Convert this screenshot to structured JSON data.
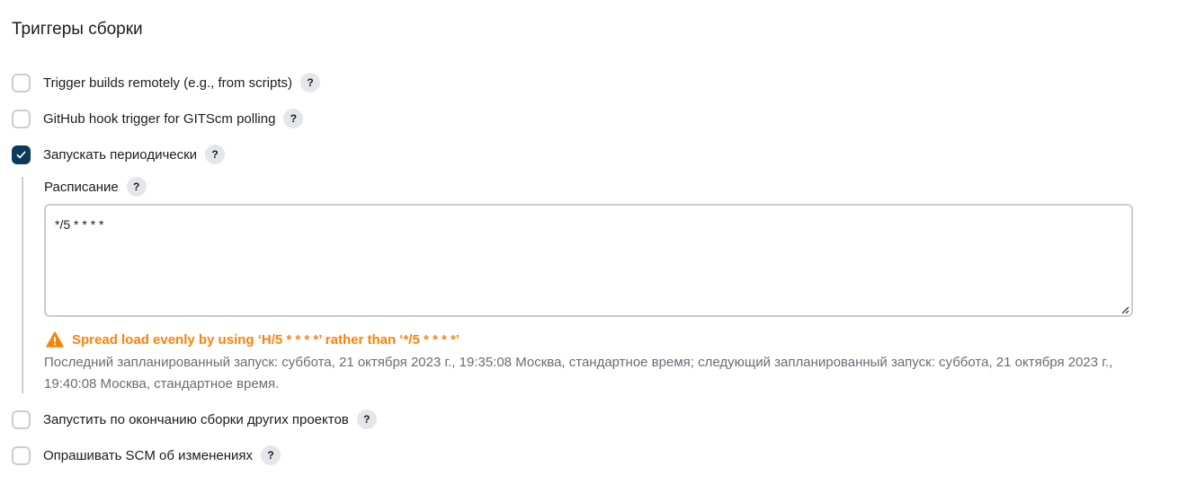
{
  "section": {
    "title": "Триггеры сборки"
  },
  "triggers": [
    {
      "label": "Trigger builds remotely (e.g., from scripts)",
      "checked": false,
      "help": "?"
    },
    {
      "label": "GitHub hook trigger for GITScm polling",
      "checked": false,
      "help": "?"
    },
    {
      "label": "Запускать периодически",
      "checked": true,
      "help": "?"
    },
    {
      "label": "Запустить по окончанию сборки других проектов",
      "checked": false,
      "help": "?"
    },
    {
      "label": "Опрашивать SCM об изменениях",
      "checked": false,
      "help": "?"
    }
  ],
  "schedule": {
    "label": "Расписание",
    "help": "?",
    "value": "*/5 * * * *",
    "warning": "Spread load evenly by using ‘H/5 * * * *’ rather than ‘*/5 * * * *’",
    "info": "Последний запланированный запуск: суббота, 21 октября 2023 г., 19:35:08 Москва, стандартное время; следующий запланированный запуск: суббота, 21 октября 2023 г., 19:40:08 Москва, стандартное время."
  },
  "colors": {
    "checked": "#0b3a5a",
    "warning": "#fe820a",
    "muted_text": "#6d6b75",
    "border": "#c9ced4"
  },
  "icons": {
    "check": "check-icon",
    "help": "help-icon",
    "warning": "warning-triangle-icon",
    "resize": "resize-handle-icon"
  }
}
